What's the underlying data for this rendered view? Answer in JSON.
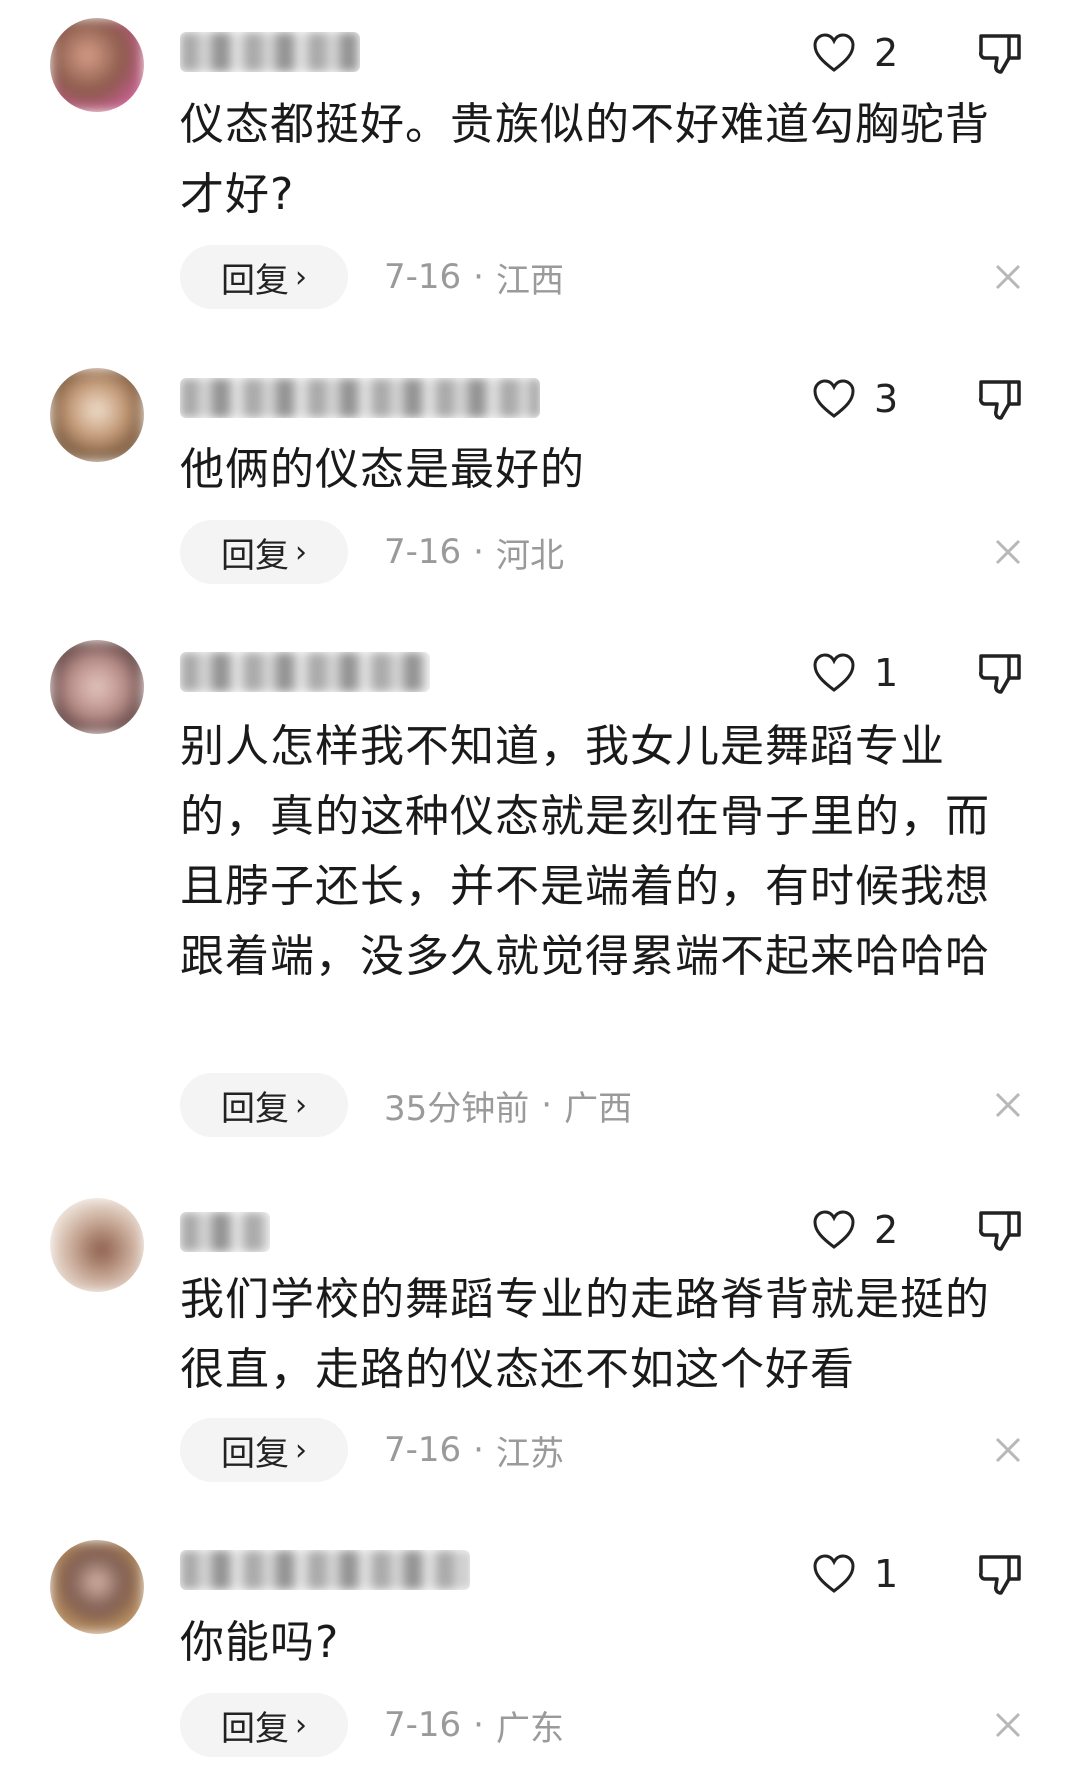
{
  "icons": {
    "like": "heart-outline-icon",
    "dislike": "thumbs-down-icon",
    "close": "close-icon"
  },
  "colors": {
    "text": "#1a1a1a",
    "meta": "#9a9a9a",
    "reply_bg": "#f4f4f4"
  },
  "comments": [
    {
      "likes": "2",
      "text": "仪态都挺好。贵族似的不好难道勾胸驼背才好?",
      "reply_label": "回复",
      "time": "7-16",
      "location": "江西"
    },
    {
      "likes": "3",
      "text": "他俩的仪态是最好的",
      "reply_label": "回复",
      "time": "7-16",
      "location": "河北"
    },
    {
      "likes": "1",
      "text": "别人怎样我不知道，我女儿是舞蹈专业的，真的这种仪态就是刻在骨子里的，而且脖子还长，并不是端着的，有时候我想跟着端，没多久就觉得累端不起来哈哈哈",
      "reply_label": "回复",
      "time": "35分钟前",
      "location": "广西"
    },
    {
      "likes": "2",
      "text": "我们学校的舞蹈专业的走路脊背就是挺的很直，走路的仪态还不如这个好看",
      "reply_label": "回复",
      "time": "7-16",
      "location": "江苏"
    },
    {
      "likes": "1",
      "text": "你能吗?",
      "reply_label": "回复",
      "time": "7-16",
      "location": "广东"
    }
  ]
}
